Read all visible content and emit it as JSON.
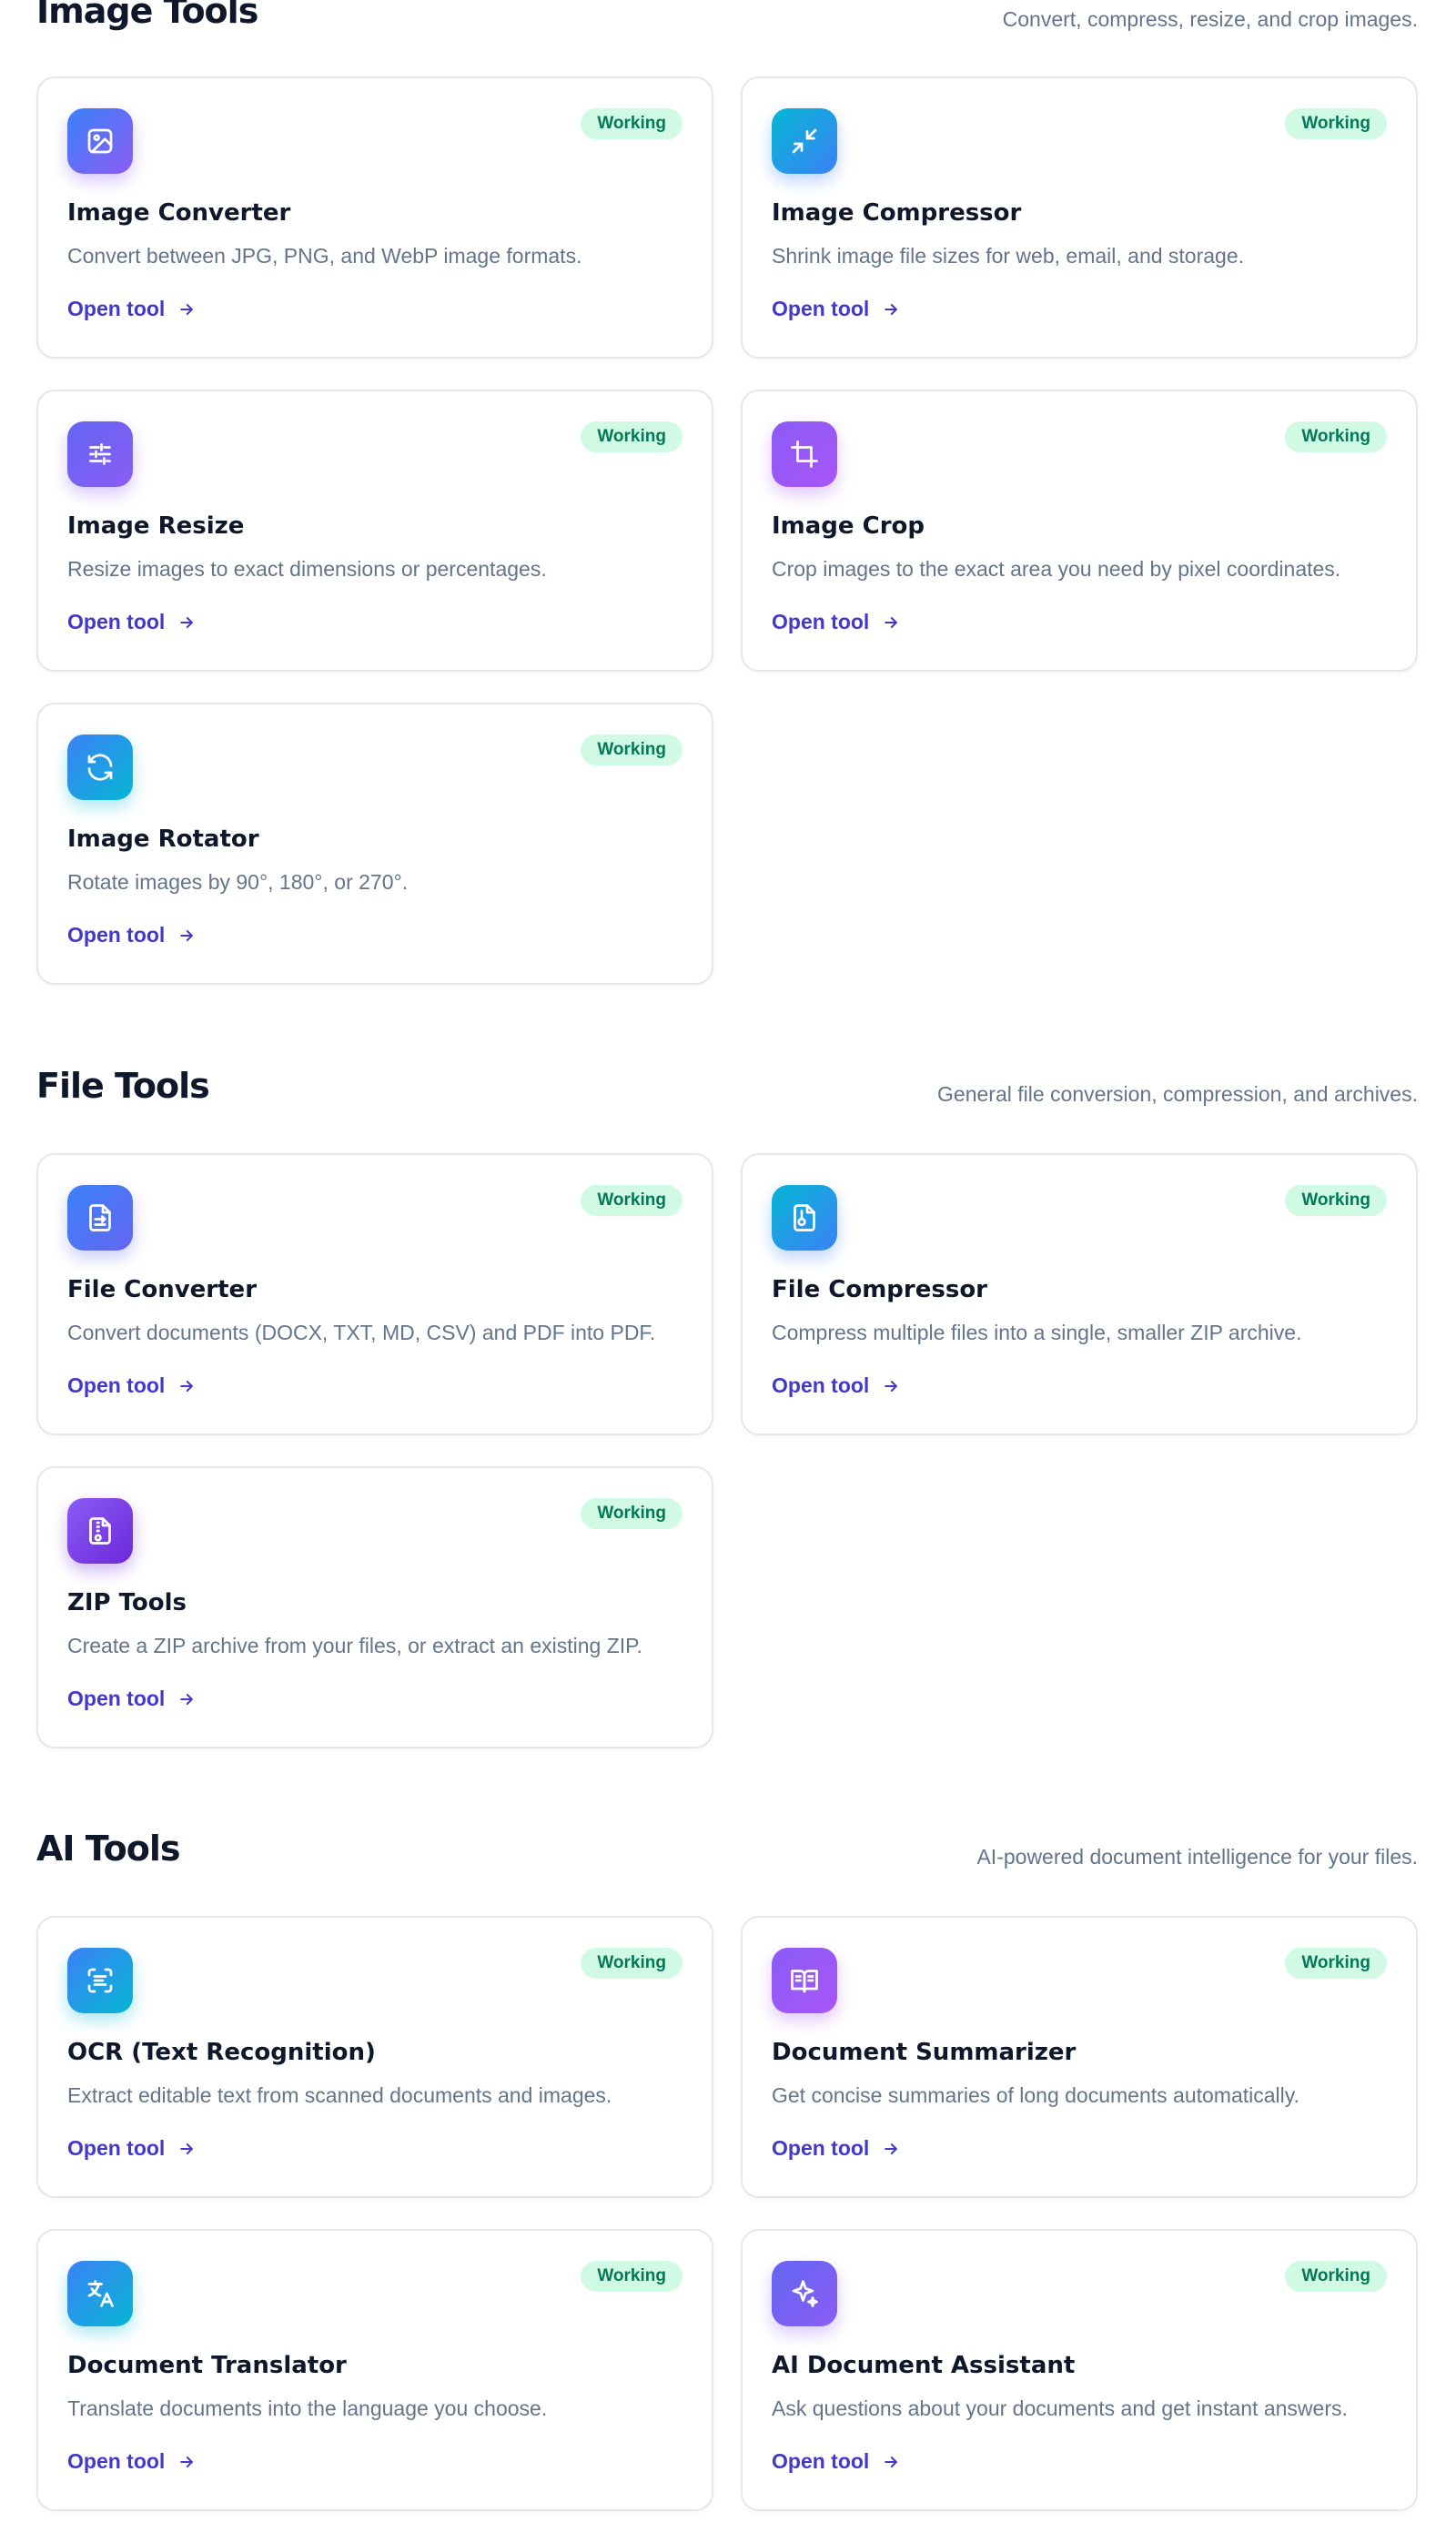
{
  "sections": [
    {
      "title": "Image Tools",
      "description": "Convert, compress, resize, and crop images.",
      "cards": [
        {
          "title": "Image Converter",
          "description": "Convert between JPG, PNG, and WebP image formats.",
          "badge": "Working",
          "link": "Open tool",
          "icon": "image-icon",
          "gradient": [
            "#3b82f6",
            "#8b5cf6"
          ]
        },
        {
          "title": "Image Compressor",
          "description": "Shrink image file sizes for web, email, and storage.",
          "badge": "Working",
          "link": "Open tool",
          "icon": "compress-arrows-icon",
          "gradient": [
            "#06b6d4",
            "#3b82f6"
          ]
        },
        {
          "title": "Image Resize",
          "description": "Resize images to exact dimensions or percentages.",
          "badge": "Working",
          "link": "Open tool",
          "icon": "sliders-icon",
          "gradient": [
            "#6366f1",
            "#8b5cf6"
          ]
        },
        {
          "title": "Image Crop",
          "description": "Crop images to the exact area you need by pixel coordinates.",
          "badge": "Working",
          "link": "Open tool",
          "icon": "crop-icon",
          "gradient": [
            "#8b5cf6",
            "#a855f7"
          ]
        },
        {
          "title": "Image Rotator",
          "description": "Rotate images by 90°, 180°, or 270°.",
          "badge": "Working",
          "link": "Open tool",
          "icon": "refresh-icon",
          "gradient": [
            "#3b82f6",
            "#06b6d4"
          ]
        }
      ]
    },
    {
      "title": "File Tools",
      "description": "General file conversion, compression, and archives.",
      "cards": [
        {
          "title": "File Converter",
          "description": "Convert documents (DOCX, TXT, MD, CSV) and PDF into PDF.",
          "badge": "Working",
          "link": "Open tool",
          "icon": "file-convert-icon",
          "gradient": [
            "#3b82f6",
            "#6366f1"
          ]
        },
        {
          "title": "File Compressor",
          "description": "Compress multiple files into a single, smaller ZIP archive.",
          "badge": "Working",
          "link": "Open tool",
          "icon": "file-compress-icon",
          "gradient": [
            "#06b6d4",
            "#3b82f6"
          ]
        },
        {
          "title": "ZIP Tools",
          "description": "Create a ZIP archive from your files, or extract an existing ZIP.",
          "badge": "Working",
          "link": "Open tool",
          "icon": "file-zip-icon",
          "gradient": [
            "#8b5cf6",
            "#6d28d9"
          ]
        }
      ]
    },
    {
      "title": "AI Tools",
      "description": "AI-powered document intelligence for your files.",
      "cards": [
        {
          "title": "OCR (Text Recognition)",
          "description": "Extract editable text from scanned documents and images.",
          "badge": "Working",
          "link": "Open tool",
          "icon": "scan-text-icon",
          "gradient": [
            "#3b82f6",
            "#06b6d4"
          ]
        },
        {
          "title": "Document Summarizer",
          "description": "Get concise summaries of long documents automatically.",
          "badge": "Working",
          "link": "Open tool",
          "icon": "book-open-icon",
          "gradient": [
            "#8b5cf6",
            "#a855f7"
          ]
        },
        {
          "title": "Document Translator",
          "description": "Translate documents into the language you choose.",
          "badge": "Working",
          "link": "Open tool",
          "icon": "translate-icon",
          "gradient": [
            "#3b82f6",
            "#06b6d4"
          ]
        },
        {
          "title": "AI Document Assistant",
          "description": "Ask questions about your documents and get instant answers.",
          "badge": "Working",
          "link": "Open tool",
          "icon": "sparkles-icon",
          "gradient": [
            "#6366f1",
            "#8b5cf6"
          ]
        }
      ]
    }
  ]
}
